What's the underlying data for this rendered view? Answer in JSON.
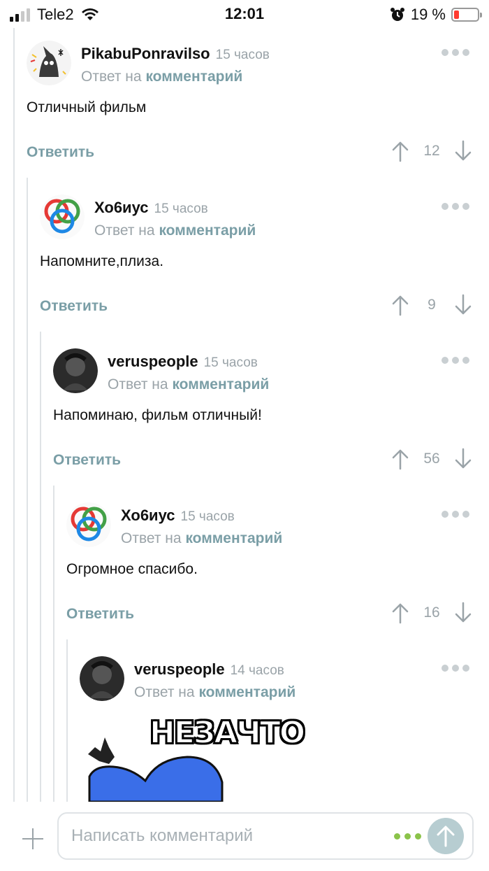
{
  "status_bar": {
    "carrier": "Tele2",
    "time": "12:01",
    "battery": "19 %"
  },
  "comments": [
    {
      "author": "PikabuPonravilso",
      "time": "15 часов",
      "reply_prefix": "Ответ на",
      "reply_link": "комментарий",
      "text": "Отличный фильм",
      "reply_label": "Ответить",
      "votes": "12",
      "avatar_icon": "cat-wizard-avatar"
    },
    {
      "author": "Хо6иус",
      "time": "15 часов",
      "reply_prefix": "Ответ на",
      "reply_link": "комментарий",
      "text": "Напомните,плиза.",
      "reply_label": "Ответить",
      "votes": "9",
      "avatar_icon": "rings-avatar"
    },
    {
      "author": "veruspeople",
      "time": "15 часов",
      "reply_prefix": "Ответ на",
      "reply_link": "комментарий",
      "text": "Напоминаю, фильм отличный!",
      "reply_label": "Ответить",
      "votes": "56",
      "avatar_icon": "dark-portrait-avatar"
    },
    {
      "author": "Хо6иус",
      "time": "15 часов",
      "reply_prefix": "Ответ на",
      "reply_link": "комментарий",
      "text": "Огромное спасибо.",
      "reply_label": "Ответить",
      "votes": "16",
      "avatar_icon": "rings-avatar"
    },
    {
      "author": "veruspeople",
      "time": "14 часов",
      "reply_prefix": "Ответ на",
      "reply_link": "комментарий",
      "meme_caption": "НЕЗАЧТО",
      "avatar_icon": "dark-portrait-avatar"
    }
  ],
  "composer": {
    "placeholder": "Написать комментарий"
  },
  "colors": {
    "accent": "#7a9ea6",
    "muted": "#9aa3a8",
    "thread_line": "#dfe3e6",
    "send_button": "#b7cdd1",
    "battery_low": "#ff3b30",
    "typing_dots": "#8bc34a"
  }
}
